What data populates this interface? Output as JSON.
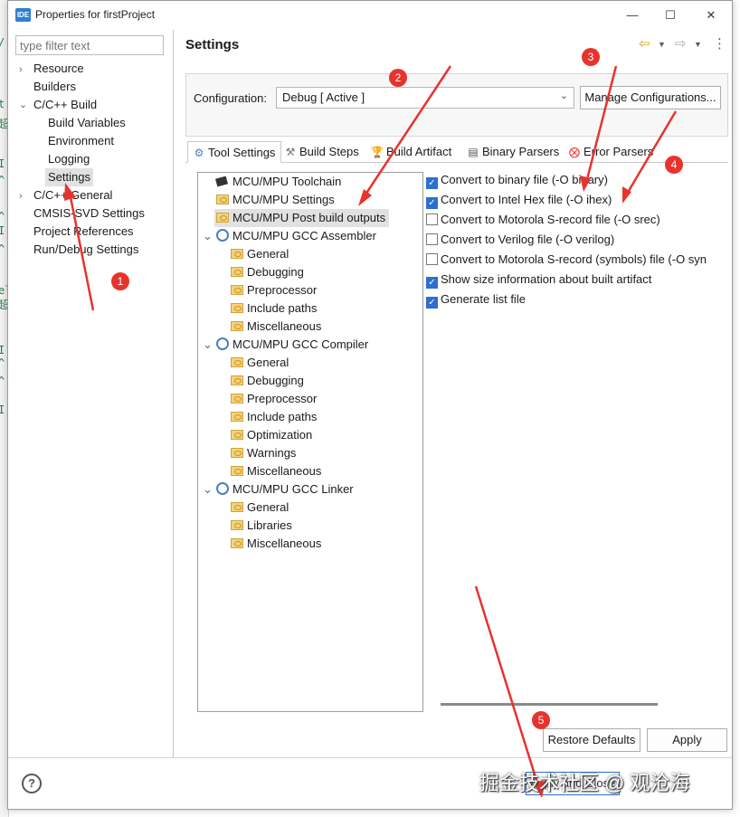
{
  "window": {
    "icon_text": "IDE",
    "title": "Properties for firstProject",
    "minimize": "—",
    "maximize": "☐",
    "close": "✕"
  },
  "sidebar": {
    "filter_placeholder": "type filter text",
    "items": [
      {
        "label": "Resource",
        "expandable": true
      },
      {
        "label": "Builders"
      },
      {
        "label": "C/C++ Build",
        "expanded": true
      },
      {
        "label": "Build Variables"
      },
      {
        "label": "Environment"
      },
      {
        "label": "Logging"
      },
      {
        "label": "Settings",
        "selected": true
      },
      {
        "label": "C/C++ General",
        "expandable": true
      },
      {
        "label": "CMSIS-SVD Settings"
      },
      {
        "label": "Project References"
      },
      {
        "label": "Run/Debug Settings"
      }
    ]
  },
  "main": {
    "title": "Settings",
    "configuration_label": "Configuration:",
    "configuration_value": "Debug  [ Active ]",
    "manage_button": "Manage Configurations...",
    "tabs": [
      {
        "label": "Tool Settings",
        "active": true
      },
      {
        "label": "Build Steps"
      },
      {
        "label": "Build Artifact"
      },
      {
        "label": "Binary Parsers"
      },
      {
        "label": "Error Parsers"
      }
    ],
    "tree": [
      {
        "label": "MCU/MPU Toolchain"
      },
      {
        "label": "MCU/MPU Settings"
      },
      {
        "label": "MCU/MPU Post build outputs",
        "selected": true
      },
      {
        "label": "MCU/MPU GCC Assembler"
      },
      {
        "label": "General"
      },
      {
        "label": "Debugging"
      },
      {
        "label": "Preprocessor"
      },
      {
        "label": "Include paths"
      },
      {
        "label": "Miscellaneous"
      },
      {
        "label": "MCU/MPU GCC Compiler"
      },
      {
        "label": "General"
      },
      {
        "label": "Debugging"
      },
      {
        "label": "Preprocessor"
      },
      {
        "label": "Include paths"
      },
      {
        "label": "Optimization"
      },
      {
        "label": "Warnings"
      },
      {
        "label": "Miscellaneous"
      },
      {
        "label": "MCU/MPU GCC Linker"
      },
      {
        "label": "General"
      },
      {
        "label": "Libraries"
      },
      {
        "label": "Miscellaneous"
      }
    ],
    "options": [
      {
        "label": "Convert to binary file (-O binary)",
        "checked": true
      },
      {
        "label": "Convert to Intel Hex file (-O ihex)",
        "checked": true
      },
      {
        "label": "Convert to Motorola S-record file (-O srec)",
        "checked": false
      },
      {
        "label": "Convert to Verilog file (-O verilog)",
        "checked": false
      },
      {
        "label": "Convert to Motorola S-record (symbols) file (-O syn",
        "checked": false
      },
      {
        "label": "Show size information about built artifact",
        "checked": true
      },
      {
        "label": "Generate list file",
        "checked": true
      }
    ],
    "restore_defaults": "Restore Defaults",
    "apply": "Apply"
  },
  "footer": {
    "help": "?",
    "apply_and_close": "Apply and Close"
  },
  "annotations": {
    "badges": [
      "1",
      "2",
      "3",
      "4",
      "5"
    ],
    "color": "#e8332d",
    "watermark": "掘金技术社区 @ 观沧海"
  },
  "background_editor": {
    "fragments": [
      "/",
      "t",
      "超",
      "I",
      "^",
      "^",
      "I",
      "^",
      "el",
      "超",
      "I",
      "^",
      "^",
      "I",
      "2",
      "超",
      "I",
      "^",
      "le",
      "Ar",
      "d"
    ]
  }
}
